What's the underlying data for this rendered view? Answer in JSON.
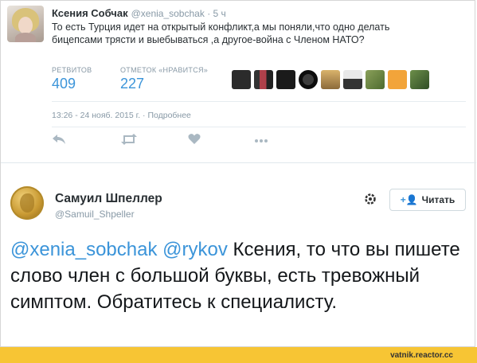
{
  "tweet1": {
    "author_name": "Ксения Собчак",
    "author_handle": "@xenia_sobchak",
    "time_ago": "· 5 ч",
    "text": "То есть Турция идет на открытый конфликт,а мы поняли,что одно делать бицепсами трясти и выебываться ,а другое-война с Членом НАТО?",
    "stats": {
      "retweets_label": "РЕТВИТОВ",
      "retweets_value": "409",
      "likes_label": "ОТМЕТОК «НРАВИТСЯ»",
      "likes_value": "227"
    },
    "timestamp": "13:26 - 24 нояб. 2015 г. · Подробнее",
    "actions": {
      "reply_icon": "reply-icon",
      "retweet_icon": "retweet-icon",
      "like_icon": "heart-icon",
      "more_icon": "more-icon"
    }
  },
  "tweet2": {
    "author_name": "Самуил Шпеллер",
    "author_handle": "@Samuil_Shpeller",
    "follow_label": "Читать",
    "mention1": "@xenia_sobchak",
    "mention2": "@rykov",
    "text": " Ксения, то что вы пишете слово член с большой буквы, есть тревожный симптом. Обратитесь к специалисту."
  },
  "footer": {
    "site": "vatnik.reactor.cc"
  },
  "colors": {
    "link": "#3b94d9",
    "muted": "#8899a6",
    "footer_bg": "#f7c534"
  }
}
